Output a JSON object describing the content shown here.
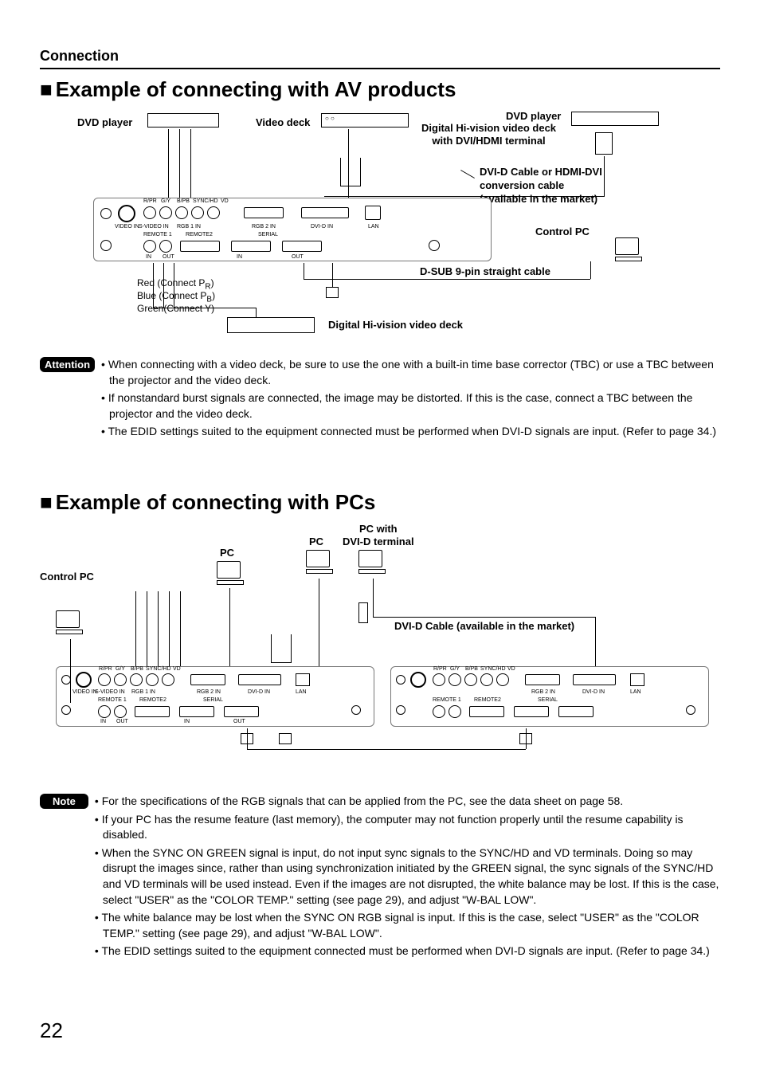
{
  "breadcrumb": "Connection",
  "section1": {
    "title": "Example of connecting with AV products",
    "labels": {
      "dvd_player": "DVD player",
      "video_deck": "Video deck",
      "dvd_player2": "DVD  player",
      "hivision_deck_dvi": "Digital Hi-vision video deck\nwith DVI/HDMI terminal",
      "dvid_cable": "DVI-D Cable or HDMI-DVI\nconversion cable\n(available in the market)",
      "control_pc": "Control PC",
      "dsub9": "D-SUB 9-pin straight cable",
      "digital_hivision": "Digital Hi-vision video deck",
      "red": "Red (Connect P",
      "red_sub": "R",
      "red_end": ")",
      "blue": "Blue (Connect P",
      "blue_sub": "B",
      "blue_end": ")",
      "green": "Green(Connect Y)"
    },
    "callout": "Attention",
    "bullets": [
      "When connecting with a video deck, be sure to use the one with a built-in time base corrector (TBC) or use a TBC between the projector and the video deck.",
      "If nonstandard burst signals are connected, the image may be distorted. If this is the case, connect a TBC between the projector and the video deck.",
      "The EDID settings suited to the equipment connected must be performed when DVI-D signals are input. (Refer to page 34.)"
    ]
  },
  "section2": {
    "title": "Example of connecting with PCs",
    "labels": {
      "control_pc": "Control PC",
      "pc1": "PC",
      "pc2": "PC",
      "pc_dvid": "PC with\nDVI-D terminal",
      "dvid_cable": "DVI-D Cable (available in the market)"
    },
    "callout": "Note",
    "bullets": [
      "For the specifications of the RGB signals that can be applied from the PC, see the data sheet on page 58.",
      "If your PC has the resume feature (last memory), the computer may not function properly until the resume capability is disabled.",
      "When the SYNC ON GREEN signal is input, do not input sync signals to the SYNC/HD and VD terminals. Doing so may disrupt the images since, rather than using synchronization initiated by the GREEN signal, the sync signals of the SYNC/HD and VD terminals will be used instead. Even if the images are not disrupted, the white balance may be lost. If this is the case, select \"USER\" as the \"COLOR TEMP.\" setting (see page 29), and adjust \"W-BAL LOW\".",
      "The white balance may be lost when the SYNC ON RGB signal is input. If this is the case, select \"USER\" as the \"COLOR TEMP.\" setting (see page 29), and adjust \"W-BAL LOW\".",
      "The EDID settings suited to the equipment connected must be performed when DVI-D signals are input. (Refer to page 34.)"
    ]
  },
  "page_number": "22",
  "port_labels": {
    "rpr": "R/PR",
    "gy": "G/Y",
    "bpb": "B/PB",
    "synchd": "SYNC/HD",
    "vd": "VD",
    "videoin": "VIDEO IN",
    "svideoin": "S-VIDEO IN",
    "rgb1in": "RGB 1 IN",
    "rgb2in": "RGB 2 IN",
    "dvidin": "DVI-D IN",
    "lan": "LAN",
    "remote1": "REMOTE 1",
    "remote2": "REMOTE2",
    "serial": "SERIAL",
    "in": "IN",
    "out": "OUT"
  }
}
